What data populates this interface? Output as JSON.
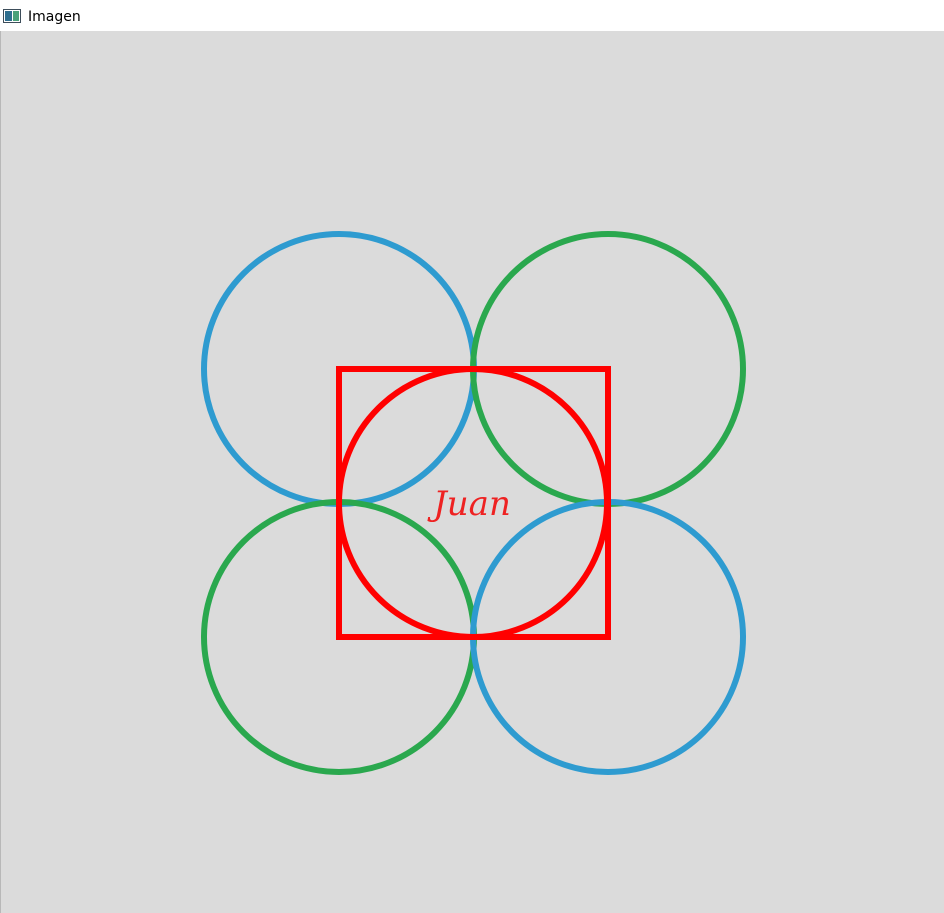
{
  "window": {
    "title": "Imagen",
    "icon": "opencv-window-icon"
  },
  "canvas": {
    "background": "#dbdbdb",
    "label": {
      "text": "Juan",
      "color": "#ee2222"
    },
    "colors": {
      "blue": "#2e9bd0",
      "green": "#2aa84e",
      "red": "#ff0000"
    }
  }
}
